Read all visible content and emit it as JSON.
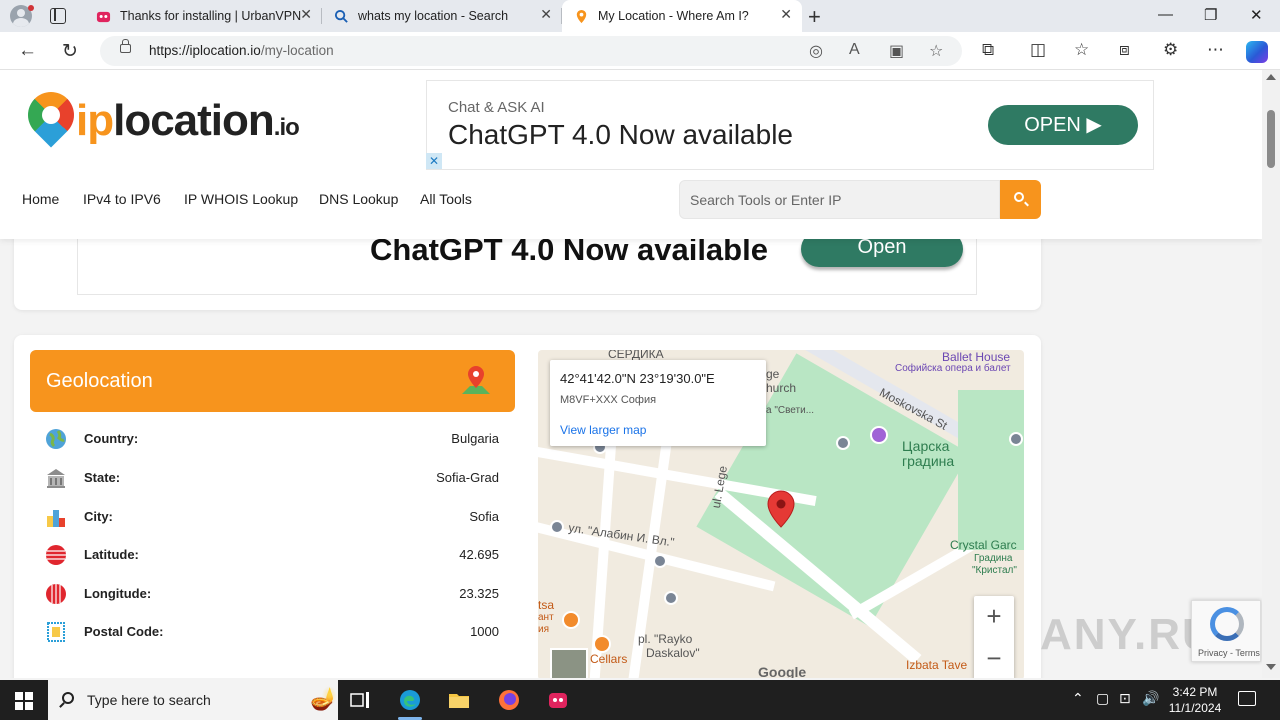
{
  "browser": {
    "tabs": [
      {
        "label": "Thanks for installing | UrbanVPN",
        "icon": "urbanvpn-icon"
      },
      {
        "label": "whats my location - Search",
        "icon": "search-icon"
      },
      {
        "label": "My Location - Where Am I?",
        "icon": "location-pin-icon"
      }
    ],
    "url_host": "https://iplocation.io",
    "url_path": "/my-location"
  },
  "site": {
    "logo_ip": "ip",
    "logo_location": "location",
    "logo_io": ".io",
    "ad_top": {
      "small": "Chat & ASK AI",
      "big": "ChatGPT 4.0 Now available",
      "button": "OPEN ▶"
    },
    "ad_close": "✕",
    "nav": [
      "Home",
      "IPv4 to IPV6",
      "IP WHOIS Lookup",
      "DNS Lookup",
      "All Tools"
    ],
    "search_placeholder": "Search Tools or Enter IP",
    "ad_second": {
      "big": "ChatGPT 4.0 Now available",
      "button": "Open"
    }
  },
  "geolocation": {
    "title": "Geolocation",
    "rows": [
      {
        "label": "Country:",
        "value": "Bulgaria",
        "icon": "globe-icon"
      },
      {
        "label": "State:",
        "value": "Sofia-Grad",
        "icon": "building-icon"
      },
      {
        "label": "City:",
        "value": "Sofia",
        "icon": "city-icon"
      },
      {
        "label": "Latitude:",
        "value": "42.695",
        "icon": "latitude-icon"
      },
      {
        "label": "Longitude:",
        "value": "23.325",
        "icon": "longitude-icon"
      },
      {
        "label": "Postal Code:",
        "value": "1000",
        "icon": "postal-stamp-icon"
      }
    ]
  },
  "map": {
    "popup_coord": "42°41'42.0\"N 23°19'30.0\"E",
    "popup_code": "M8VF+XXX София",
    "popup_link": "View larger map",
    "labels": {
      "serdika": "СЕРДИКА",
      "ballet": "Ballet House",
      "ballet_sub": "Софийска опера и балет",
      "church": "ge",
      "church2": "hurch",
      "church3": "а \"Свети...",
      "moskovska": "Moskovska St",
      "garden": "Царска",
      "garden2": "градина",
      "lege": "ul. Lege",
      "alabin": "ул. \"Алабин И. Вл.\"",
      "crystal": "Crystal Garc",
      "crystal2": "Градина",
      "crystal3": "\"Кристал\"",
      "rayko": "pl. \"Rayko",
      "rayko2": "Daskalov\"",
      "cellars": "Cellars",
      "izbata": "Izbata Tave",
      "tsa": "tsa",
      "tsa2": "ант",
      "tsa3": "ия",
      "google": "Google"
    },
    "zoom_in": "+",
    "zoom_out": "−"
  },
  "recaptcha": {
    "text": "Privacy - Terms"
  },
  "watermark": "ANY.RUN",
  "taskbar": {
    "search_placeholder": "Type here to search",
    "time": "3:42 PM",
    "date": "11/1/2024"
  }
}
